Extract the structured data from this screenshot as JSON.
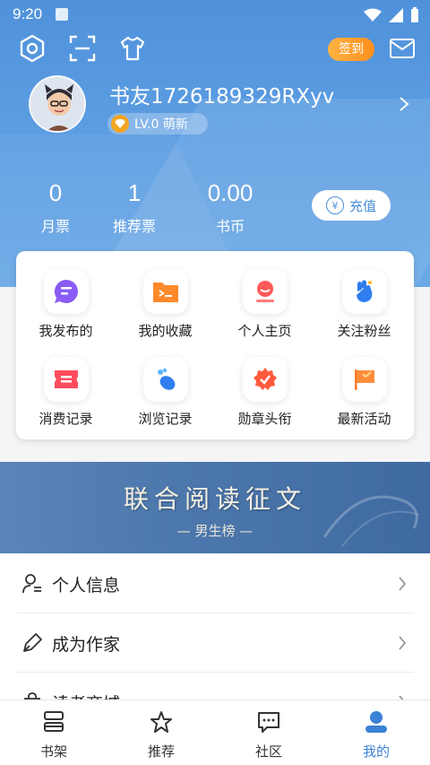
{
  "status_bar": {
    "time": "9:20"
  },
  "header": {
    "sign_in_label": "签到",
    "username": "书友1726189329RXyv",
    "level": "LV.0  萌新",
    "accent": "#4f92db"
  },
  "stats": [
    {
      "value": "0",
      "label": "月票"
    },
    {
      "value": "1",
      "label": "推荐票"
    },
    {
      "value": "0.00",
      "label": "书币"
    }
  ],
  "recharge": {
    "label": "充值",
    "icon_text": "¥"
  },
  "grid": [
    {
      "label": "我发布的",
      "icon": "post-icon"
    },
    {
      "label": "我的收藏",
      "icon": "collection-icon"
    },
    {
      "label": "个人主页",
      "icon": "homepage-icon"
    },
    {
      "label": "关注粉丝",
      "icon": "follow-icon"
    },
    {
      "label": "消费记录",
      "icon": "ticket-icon"
    },
    {
      "label": "浏览记录",
      "icon": "footprint-icon"
    },
    {
      "label": "勋章头衔",
      "icon": "medal-icon"
    },
    {
      "label": "最新活动",
      "icon": "flag-icon"
    }
  ],
  "banner": {
    "title": "联合阅读征文",
    "subtitle": "— 男生榜 —"
  },
  "list": [
    {
      "label": "个人信息",
      "icon": "person-icon"
    },
    {
      "label": "成为作家",
      "icon": "pen-icon"
    },
    {
      "label": "读者商城",
      "icon": "shop-icon"
    }
  ],
  "bottom_nav": [
    {
      "label": "书架",
      "icon": "bookshelf-icon"
    },
    {
      "label": "推荐",
      "icon": "star-icon"
    },
    {
      "label": "社区",
      "icon": "chat-icon"
    },
    {
      "label": "我的",
      "icon": "user-icon",
      "active": true
    }
  ]
}
